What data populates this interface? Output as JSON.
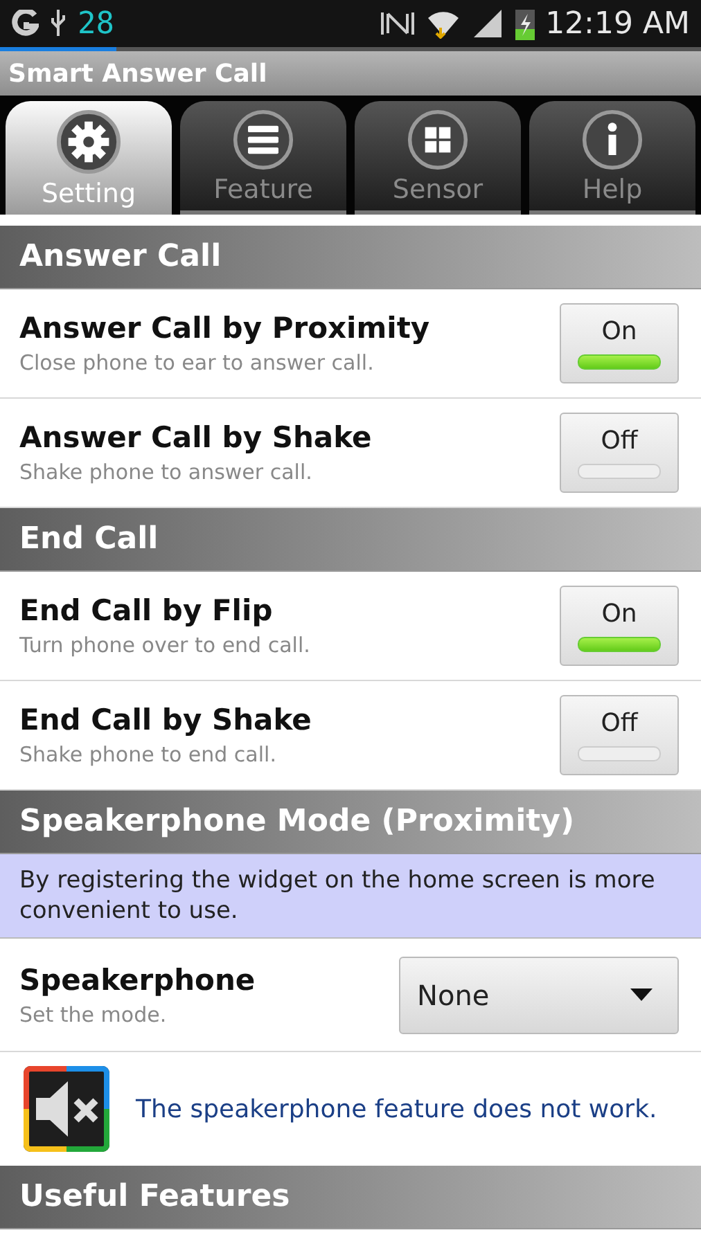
{
  "status_bar": {
    "notification_count": "28",
    "time": "12:19 AM"
  },
  "app_bar": {
    "title": "Smart Answer Call"
  },
  "tabs": [
    {
      "label": "Setting",
      "kind": "gear",
      "selected": true
    },
    {
      "label": "Feature",
      "kind": "list",
      "selected": false
    },
    {
      "label": "Sensor",
      "kind": "grid",
      "selected": false
    },
    {
      "label": "Help",
      "kind": "info",
      "selected": false
    }
  ],
  "sections": [
    {
      "kind": "header",
      "title": "Answer Call"
    },
    {
      "kind": "toggle",
      "title": "Answer Call by Proximity",
      "subtitle": "Close phone to ear to answer call.",
      "button": "On",
      "on": true
    },
    {
      "kind": "toggle",
      "title": "Answer Call by Shake",
      "subtitle": "Shake phone to answer call.",
      "button": "Off",
      "on": false
    },
    {
      "kind": "header",
      "title": "End Call"
    },
    {
      "kind": "toggle",
      "title": "End Call by Flip",
      "subtitle": "Turn phone over to end call.",
      "button": "On",
      "on": true
    },
    {
      "kind": "toggle",
      "title": "End Call by Shake",
      "subtitle": "Shake phone to end call.",
      "button": "Off",
      "on": false
    },
    {
      "kind": "header",
      "title": "Speakerphone Mode (Proximity)"
    },
    {
      "kind": "info",
      "text": "By registering the widget on the home screen is more convenient to use."
    },
    {
      "kind": "select",
      "title": "Speakerphone",
      "subtitle": "Set the mode.",
      "value": "None"
    },
    {
      "kind": "notice",
      "text": "The speakerphone feature does not work."
    },
    {
      "kind": "header",
      "title": "Useful Features"
    }
  ]
}
